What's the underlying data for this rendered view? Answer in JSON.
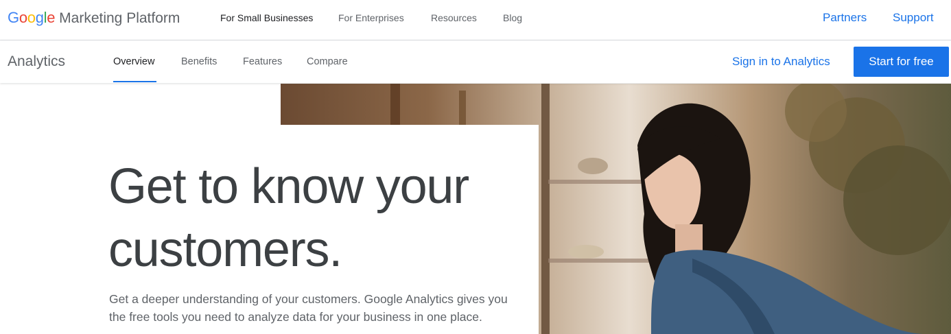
{
  "brand": {
    "google_letters": [
      "G",
      "o",
      "o",
      "g",
      "l",
      "e"
    ],
    "platform": "Marketing Platform"
  },
  "topnav": {
    "items": [
      {
        "label": "For Small Businesses",
        "active": true
      },
      {
        "label": "For Enterprises",
        "active": false
      },
      {
        "label": "Resources",
        "active": false
      },
      {
        "label": "Blog",
        "active": false
      }
    ],
    "partners": "Partners",
    "support": "Support"
  },
  "subnav": {
    "product": "Analytics",
    "items": [
      {
        "label": "Overview",
        "active": true
      },
      {
        "label": "Benefits",
        "active": false
      },
      {
        "label": "Features",
        "active": false
      },
      {
        "label": "Compare",
        "active": false
      }
    ],
    "signin": "Sign in to Analytics",
    "start": "Start for free"
  },
  "hero": {
    "headline": "Get to know your customers.",
    "description": "Get a deeper understanding of your customers. Google Analytics gives you the free tools you need to analyze data for your business in one place."
  },
  "colors": {
    "accent": "#1a73e8",
    "google_blue": "#4285F4",
    "google_red": "#EA4335",
    "google_yellow": "#FBBC05",
    "google_green": "#34A853"
  }
}
